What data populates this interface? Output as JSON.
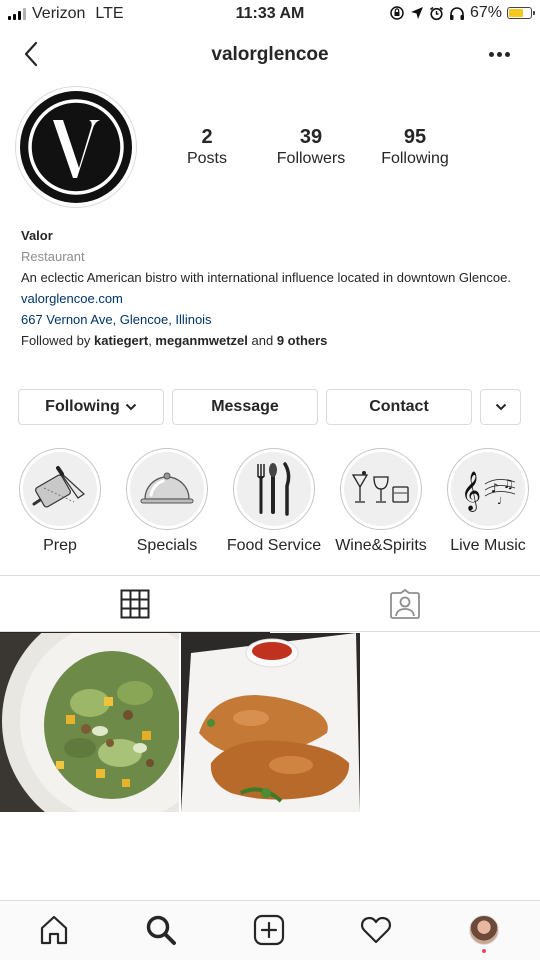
{
  "status_bar": {
    "carrier": "Verizon",
    "network": "LTE",
    "time": "11:33 AM",
    "battery_percent": "67%",
    "battery_level": 0.67,
    "battery_color": "#f5c81e",
    "icons": [
      "screen-rotation-lock-icon",
      "location-arrow-icon",
      "alarm-icon",
      "headphones-icon"
    ]
  },
  "header": {
    "username": "valorglencoe"
  },
  "profile": {
    "stats": [
      {
        "value": "2",
        "label": "Posts"
      },
      {
        "value": "39",
        "label": "Followers"
      },
      {
        "value": "95",
        "label": "Following"
      }
    ],
    "name": "Valor",
    "category": "Restaurant",
    "bio": "An eclectic American bistro with international influence located in downtown Glencoe.",
    "website": "valorglencoe.com",
    "address": "667 Vernon Ave, Glencoe, Illinois",
    "followed_by": {
      "prefix": "Followed by ",
      "user1": "katiegert",
      "separator": ", ",
      "user2": "meganmwetzel",
      "middle": " and ",
      "others": "9 others"
    }
  },
  "buttons": {
    "following": "Following",
    "message": "Message",
    "contact": "Contact"
  },
  "highlights": [
    {
      "label": "Prep",
      "icon": "cutting-board-knife-icon"
    },
    {
      "label": "Specials",
      "icon": "cloche-icon"
    },
    {
      "label": "Food Service",
      "icon": "fork-knife-icon"
    },
    {
      "label": "Wine&Spirits",
      "icon": "glasses-icon"
    },
    {
      "label": "Live Music",
      "icon": "music-notes-icon"
    }
  ],
  "tabs": [
    {
      "name": "grid",
      "icon": "grid-icon",
      "active": true
    },
    {
      "name": "tagged",
      "icon": "tagged-person-icon",
      "active": false
    }
  ],
  "posts": [
    {
      "subject": "salad",
      "icon": "salad-photo"
    },
    {
      "subject": "fried chicken",
      "icon": "fried-chicken-photo"
    }
  ],
  "bottom_nav": [
    "home-icon",
    "search-icon",
    "add-post-icon",
    "activity-heart-icon",
    "profile-avatar"
  ],
  "colors": {
    "link": "#003569",
    "muted": "#8e8e8e",
    "border": "#dbdbdb",
    "notification": "#ed4956"
  }
}
